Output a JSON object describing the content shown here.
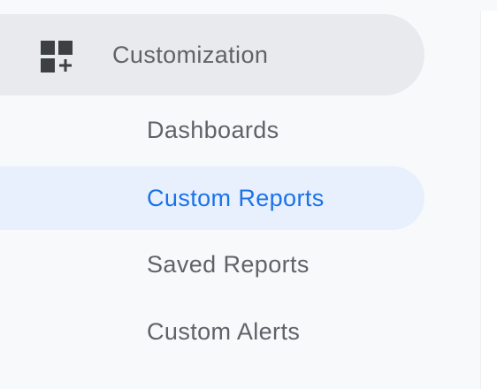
{
  "nav": {
    "section": {
      "label": "Customization",
      "icon": "dashboard-customize-icon"
    },
    "items": [
      {
        "label": "Dashboards",
        "active": false
      },
      {
        "label": "Custom Reports",
        "active": true
      },
      {
        "label": "Saved Reports",
        "active": false
      },
      {
        "label": "Custom Alerts",
        "active": false
      }
    ]
  },
  "colors": {
    "sidebar_background": "#f8f9fa",
    "section_header_background": "#e8eaed",
    "active_item_background": "#e8f0fe",
    "active_text": "#1a73e8",
    "text": "#5f6368",
    "icon": "#3c4043"
  }
}
